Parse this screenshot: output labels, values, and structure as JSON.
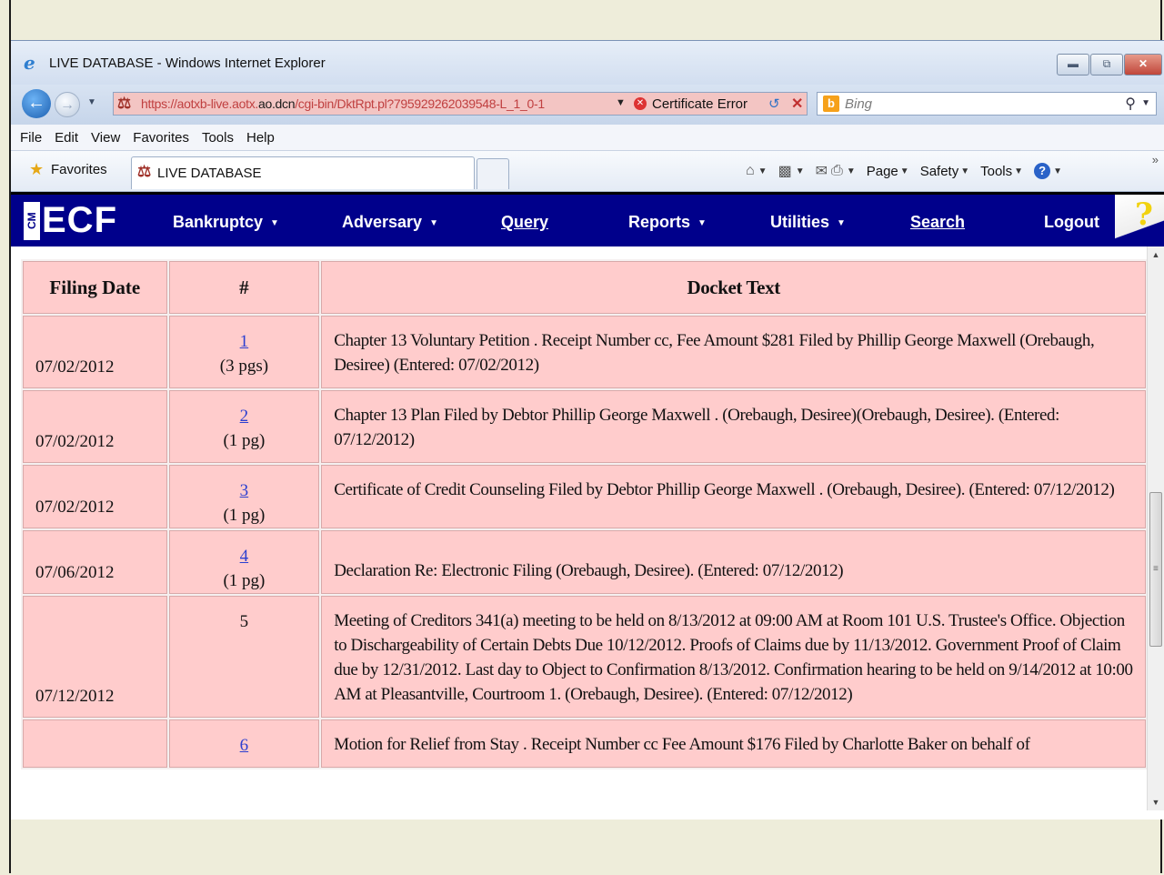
{
  "browser": {
    "title": "LIVE DATABASE - Windows Internet Explorer",
    "url_host": "https://aotxb-live.aotx.",
    "url_domain": "ao.dcn",
    "url_path": "/cgi-bin/DktRpt.pl?795929262039548-L_1_0-1",
    "certificate_error": "Certificate Error",
    "search_placeholder": "Bing",
    "menu": [
      "File",
      "Edit",
      "View",
      "Favorites",
      "Tools",
      "Help"
    ],
    "favorites_label": "Favorites",
    "tab_title": "LIVE DATABASE",
    "command_bar": {
      "page": "Page",
      "safety": "Safety",
      "tools": "Tools"
    }
  },
  "ecf": {
    "logo_cm": "CM",
    "logo_text": "ECF",
    "nav": {
      "bankruptcy": "Bankruptcy",
      "adversary": "Adversary",
      "query": "Query",
      "reports": "Reports",
      "utilities": "Utilities",
      "search": "Search",
      "logout": "Logout"
    }
  },
  "docket": {
    "headers": {
      "filing_date": "Filing Date",
      "number": "#",
      "docket_text": "Docket Text"
    },
    "rows": [
      {
        "date": "07/02/2012",
        "num": "1",
        "pages": "(3 pgs)",
        "text": "Chapter 13 Voluntary Petition . Receipt Number cc, Fee Amount $281 Filed by Phillip George Maxwell (Orebaugh, Desiree) (Entered: 07/02/2012)"
      },
      {
        "date": "07/02/2012",
        "num": "2",
        "pages": "(1 pg)",
        "text": "Chapter 13 Plan Filed by Debtor Phillip George Maxwell . (Orebaugh, Desiree)(Orebaugh, Desiree). (Entered: 07/12/2012)"
      },
      {
        "date": "07/02/2012",
        "num": "3",
        "pages": "(1 pg)",
        "text": "Certificate of Credit Counseling Filed by Debtor Phillip George Maxwell . (Orebaugh, Desiree). (Entered: 07/12/2012)"
      },
      {
        "date": "07/06/2012",
        "num": "4",
        "pages": "(1 pg)",
        "text": "Declaration Re: Electronic Filing (Orebaugh, Desiree). (Entered: 07/12/2012)"
      },
      {
        "date": "07/12/2012",
        "num": "5",
        "pages": "",
        "text": "Meeting of Creditors 341(a) meeting to be held on 8/13/2012 at 09:00 AM at Room 101 U.S. Trustee's Office. Objection to Dischargeability of Certain Debts Due 10/12/2012. Proofs of Claims due by 11/13/2012. Government Proof of Claim due by 12/31/2012. Last day to Object to Confirmation 8/13/2012. Confirmation hearing to be held on 9/14/2012 at 10:00 AM at Pleasantville, Courtroom 1. (Orebaugh, Desiree). (Entered: 07/12/2012)"
      },
      {
        "date": "",
        "num": "6",
        "pages": "",
        "text": "Motion for Relief from Stay . Receipt Number cc Fee Amount $176 Filed by Charlotte Baker on behalf of"
      }
    ]
  }
}
